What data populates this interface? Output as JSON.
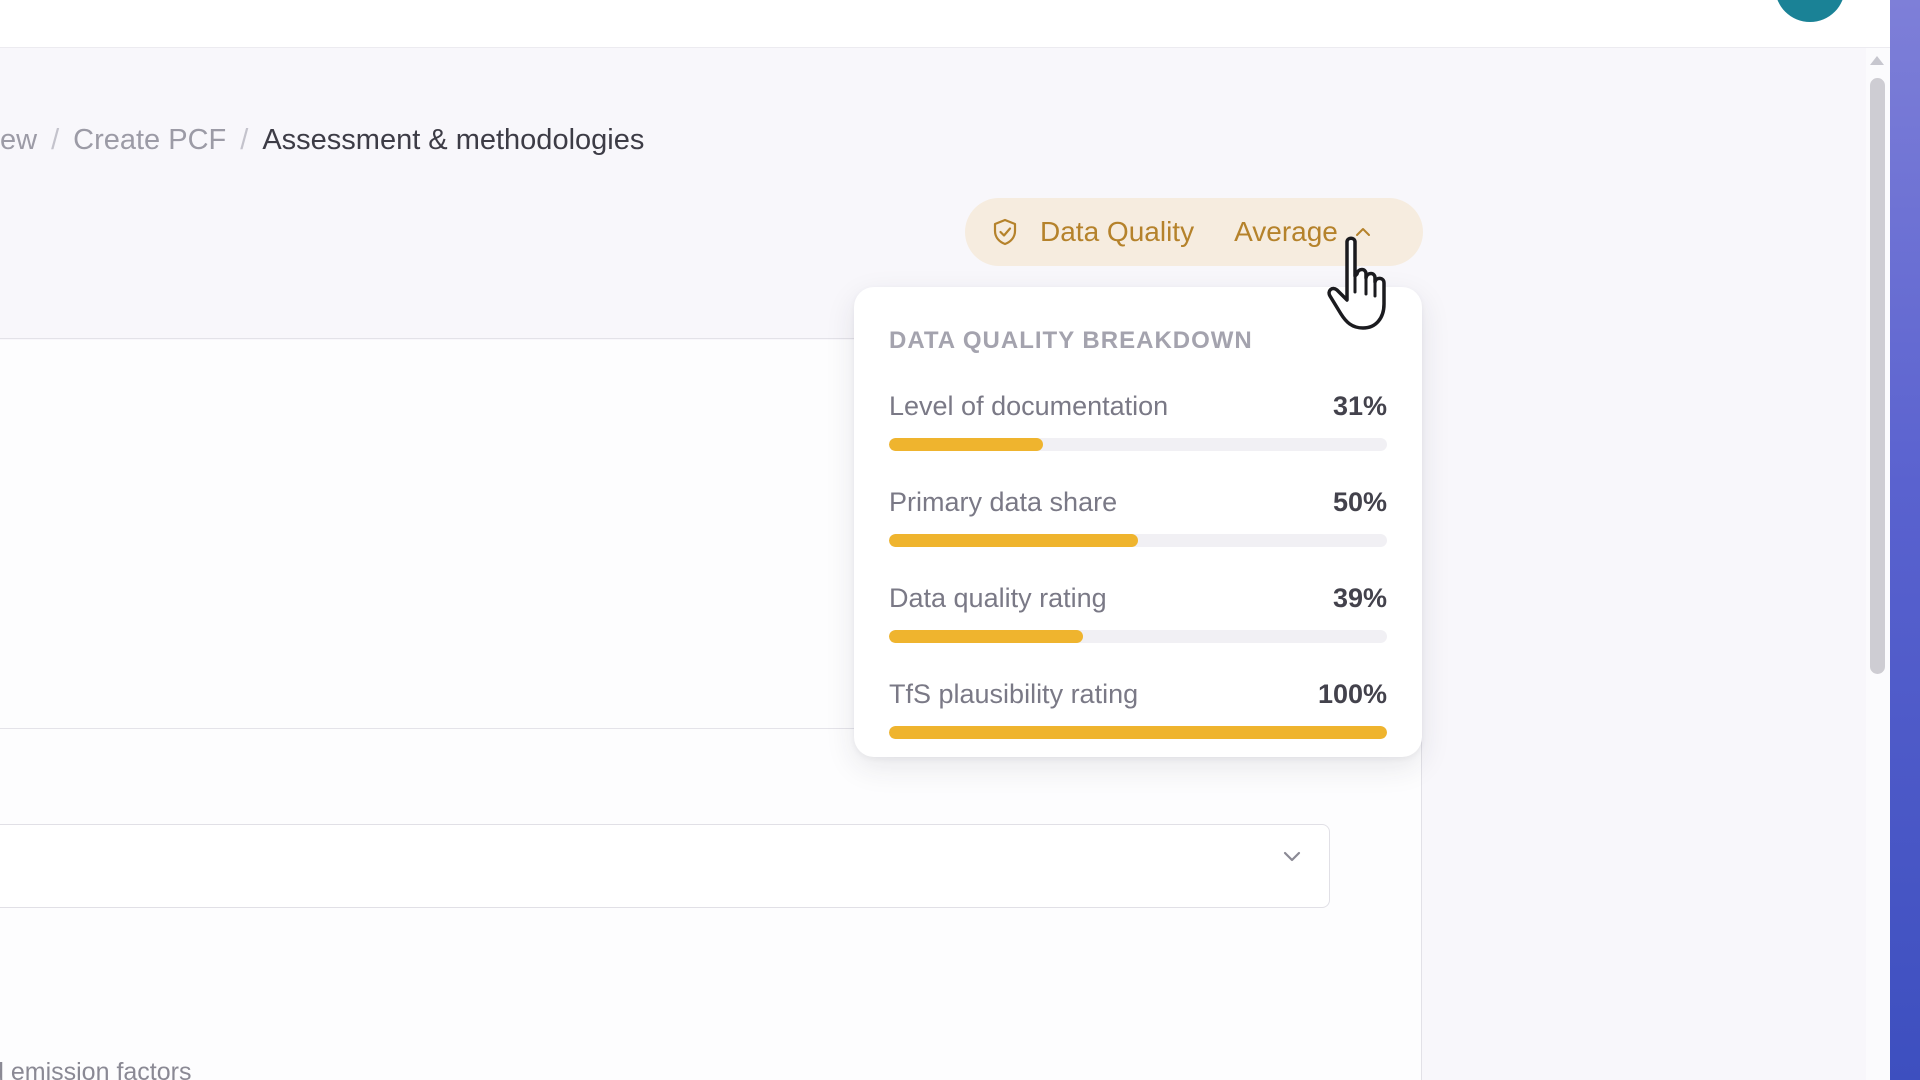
{
  "breadcrumb": {
    "items": [
      "ew",
      "Create PCF"
    ],
    "separator": "/",
    "current": "Assessment & methodologies"
  },
  "data_quality": {
    "label": "Data Quality",
    "value": "Average",
    "icons": {
      "shield": "shield-check-icon",
      "toggle": "chevron-up-icon"
    },
    "panel": {
      "heading": "DATA QUALITY BREAKDOWN",
      "rows": [
        {
          "label": "Level of documentation",
          "percent_text": "31%",
          "value": 31
        },
        {
          "label": "Primary data share",
          "percent_text": "50%",
          "value": 50
        },
        {
          "label": "Data quality rating",
          "percent_text": "39%",
          "value": 39
        },
        {
          "label": "TfS plausibility rating",
          "percent_text": "100%",
          "value": 100
        }
      ]
    }
  },
  "content": {
    "partial_label": "d emission factors",
    "select_chevron": "chevron-down-icon"
  },
  "colors": {
    "accent_text": "#b5822b",
    "pill_background": "#f6ecdf",
    "bar_fill": "#efb42e",
    "bar_track": "#f1f0f4",
    "avatar": "#1a8296"
  }
}
